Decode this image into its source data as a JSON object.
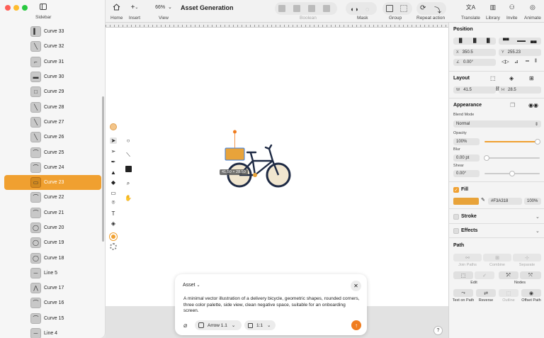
{
  "app": {
    "doc_title": "Asset Generation",
    "zoom": "66%"
  },
  "toolbar": {
    "sidebar_label": "Sidebar",
    "home_label": "Home",
    "insert_label": "Insert",
    "view_label": "View",
    "boolean_label": "Boolean",
    "mask_label": "Mask",
    "group_label": "Group",
    "repeat_label": "Repeat action",
    "translate_label": "Translate",
    "library_label": "Library",
    "invite_label": "Invite",
    "animate_label": "Animate"
  },
  "sidebar": {
    "items": [
      {
        "label": "Curve 33"
      },
      {
        "label": "Curve 32"
      },
      {
        "label": "Curve 31"
      },
      {
        "label": "Curve 30"
      },
      {
        "label": "Curve 29"
      },
      {
        "label": "Curve 28"
      },
      {
        "label": "Curve 27"
      },
      {
        "label": "Curve 26"
      },
      {
        "label": "Curve 25"
      },
      {
        "label": "Curve 24"
      },
      {
        "label": "Curve 23"
      },
      {
        "label": "Curve 22"
      },
      {
        "label": "Curve 21"
      },
      {
        "label": "Curve 20"
      },
      {
        "label": "Curve 19"
      },
      {
        "label": "Curve 18"
      },
      {
        "label": "Line 5"
      },
      {
        "label": "Curve 17"
      },
      {
        "label": "Curve 16"
      },
      {
        "label": "Curve 15"
      },
      {
        "label": "Line 4"
      }
    ],
    "selected_label": "Curve 23"
  },
  "canvas": {
    "size_label": "41.50 × 28.50"
  },
  "prompt": {
    "header": "Asset",
    "text": "A minimal vector illustration of a delivery bicycle, geometric shapes, rounded corners, three color palette, side view, clean negative space, suitable for an onboarding screen.",
    "style_chip": "Arrow 1.1",
    "ratio_chip": "1:1",
    "help": "?"
  },
  "panel": {
    "position_title": "Position",
    "x_key": "X",
    "x_value": "350.5",
    "y_key": "Y",
    "y_value": "255.23",
    "rotation_value": "0.00°",
    "layout_title": "Layout",
    "w_key": "W",
    "w_value": "41.5",
    "h_key": "H",
    "h_value": "28.5",
    "appearance_title": "Appearance",
    "blend_label": "Blend Mode",
    "blend_value": "Normal",
    "opacity_label": "Opacity",
    "opacity_value": "100%",
    "opacity_level": 1.0,
    "blur_label": "Blur",
    "blur_value": "0.00 pt",
    "shear_label": "Shear",
    "shear_value": "0.00°",
    "fill_label": "Fill",
    "fill_hex": "#F3A318",
    "fill_opacity": "100%",
    "stroke_label": "Stroke",
    "effects_label": "Effects",
    "path_title": "Path",
    "join_paths": "Join Paths",
    "combine": "Combine",
    "separate": "Separate",
    "edit": "Edit",
    "nodes": "Nodes",
    "text_on_path": "Text on Path",
    "reverse": "Reverse",
    "outline": "Outline",
    "offset_path": "Offset Path"
  },
  "colors": {
    "accent": "#F0A030",
    "fill_swatch": "#E8A33A",
    "send": "#F07C1E",
    "bike_frame": "#1E2A44",
    "wheel_fill": "#F1E6CF"
  }
}
